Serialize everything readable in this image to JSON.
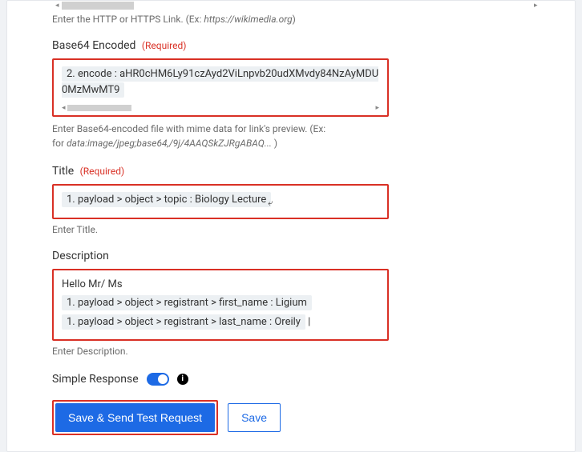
{
  "httpHelper": {
    "prefix": "Enter the HTTP or HTTPS Link. (Ex: ",
    "italic": "https://wikimedia.org",
    "suffix": ")"
  },
  "base64": {
    "label": "Base64 Encoded",
    "required": "(Required)",
    "token": "2. encode : aHR0cHM6Ly91czAyd2ViLnpvb20udXMvdy84NzAyMDU0MzMwMT9",
    "helper1": "Enter Base64-encoded file with mime data for link's preview. (Ex:",
    "helper2_prefix": "for ",
    "helper2_italic": "data:image/jpeg;base64,/9j/4AAQSkZJRgABAQ...",
    "helper2_suffix": " )"
  },
  "title": {
    "label": "Title",
    "required": "(Required)",
    "token": "1. payload > object > topic : Biology Lecture",
    "helper": "Enter Title."
  },
  "description": {
    "label": "Description",
    "plain": "Hello Mr/ Ms",
    "token1": "1. payload > object > registrant > first_name : Ligium",
    "token2": "1. payload > object > registrant > last_name : Oreily",
    "helper": "Enter Description."
  },
  "toggle": {
    "label": "Simple Response"
  },
  "buttons": {
    "primary": "Save & Send Test Request",
    "secondary": "Save"
  }
}
